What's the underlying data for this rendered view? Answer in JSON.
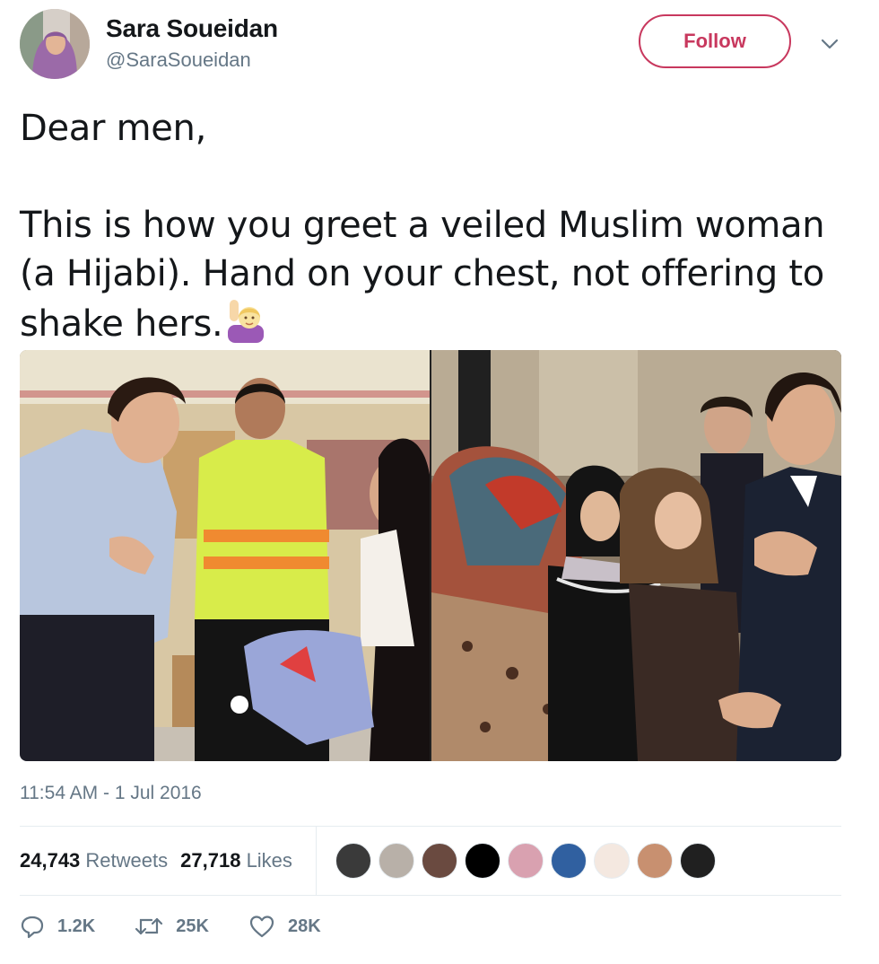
{
  "user": {
    "display_name": "Sara Soueidan",
    "handle": "@SaraSoueidan",
    "avatar_icon": "profile-photo"
  },
  "follow_button": {
    "label": "Follow"
  },
  "menu_icon": "chevron-down-icon",
  "tweet": {
    "line1": "Dear men,",
    "line2": "This is how you greet a veiled Muslim woman (a Hijabi). Hand on your chest, not offering to shake hers.",
    "emoji": "woman-raising-hand-emoji"
  },
  "media": [
    {
      "icon": "photo-greeting-volunteer"
    },
    {
      "icon": "photo-greeting-hijabi-women"
    }
  ],
  "timestamp": "11:54 AM - 1 Jul 2016",
  "stats": {
    "retweets_count": "24,743",
    "retweets_label": "Retweets",
    "likes_count": "27,718",
    "likes_label": "Likes"
  },
  "liker_colors": [
    "#3a3a3a",
    "#b8b0a8",
    "#6a4a40",
    "#000000",
    "#d9a1b0",
    "#3060a0",
    "#f4e8e0",
    "#c89070",
    "#202020"
  ],
  "actions": {
    "replies": "1.2K",
    "retweets": "25K",
    "likes": "28K"
  },
  "colors": {
    "accent": "#c8385e",
    "muted": "#657786"
  }
}
